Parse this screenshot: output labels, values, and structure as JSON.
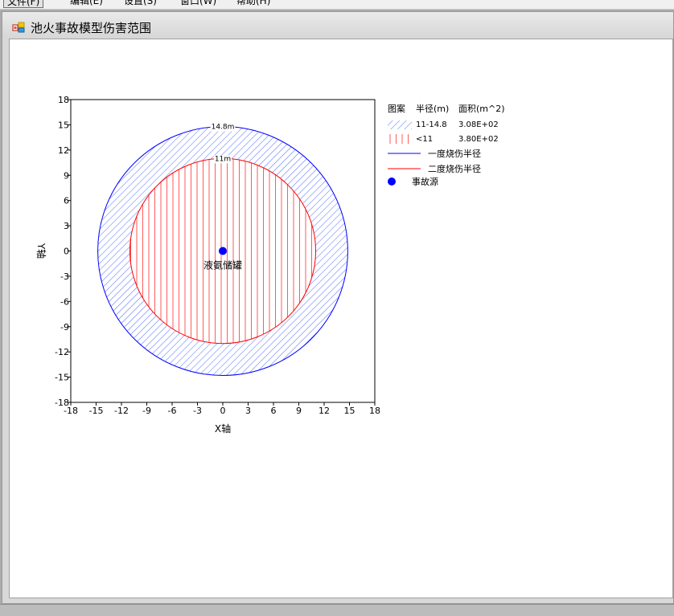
{
  "menu": {
    "items": [
      "文件(F)",
      "编辑(E)",
      "设置(S)",
      "窗口(W)",
      "帮助(H)"
    ]
  },
  "window": {
    "title": "池火事故模型伤害范围"
  },
  "colors": {
    "first_degree": "#0000ff",
    "second_degree": "#ff0000",
    "source": "#0000ff",
    "hatch_blue": "#4f6cff",
    "hatch_red": "#ff4d4d"
  },
  "chart_data": {
    "type": "scatter",
    "xlabel": "X轴",
    "ylabel": "Y轴",
    "xlim": [
      -18,
      18
    ],
    "ylim": [
      -18,
      18
    ],
    "ticks": [
      -18,
      -15,
      -12,
      -9,
      -6,
      -3,
      0,
      3,
      6,
      9,
      12,
      15,
      18
    ],
    "grid": false,
    "circles": [
      {
        "name": "一度烧伤半径",
        "radius": 14.8,
        "label": "14.8m",
        "color": "#0000ff",
        "fill": "diagonal-hatch"
      },
      {
        "name": "二度烧伤半径",
        "radius": 11,
        "label": "11m",
        "color": "#ff0000",
        "fill": "vertical-hatch"
      }
    ],
    "points": [
      {
        "name": "事故源",
        "x": 0,
        "y": 0,
        "label": "液氨储罐",
        "color": "#0000ff"
      }
    ],
    "legend": {
      "placement": "right",
      "headers": {
        "pattern": "图案",
        "radius": "半径(m)",
        "area": "面积(m^2)"
      },
      "rows": [
        {
          "symbol": "diagonal-hatch",
          "radius": "11-14.8",
          "area": "3.08E+02"
        },
        {
          "symbol": "vertical-hatch",
          "radius": "<11",
          "area": "3.80E+02"
        },
        {
          "symbol": "blue-line",
          "label": "一度烧伤半径"
        },
        {
          "symbol": "red-line",
          "label": "二度烧伤半径"
        },
        {
          "symbol": "blue-dot",
          "label": "事故源"
        }
      ]
    }
  }
}
